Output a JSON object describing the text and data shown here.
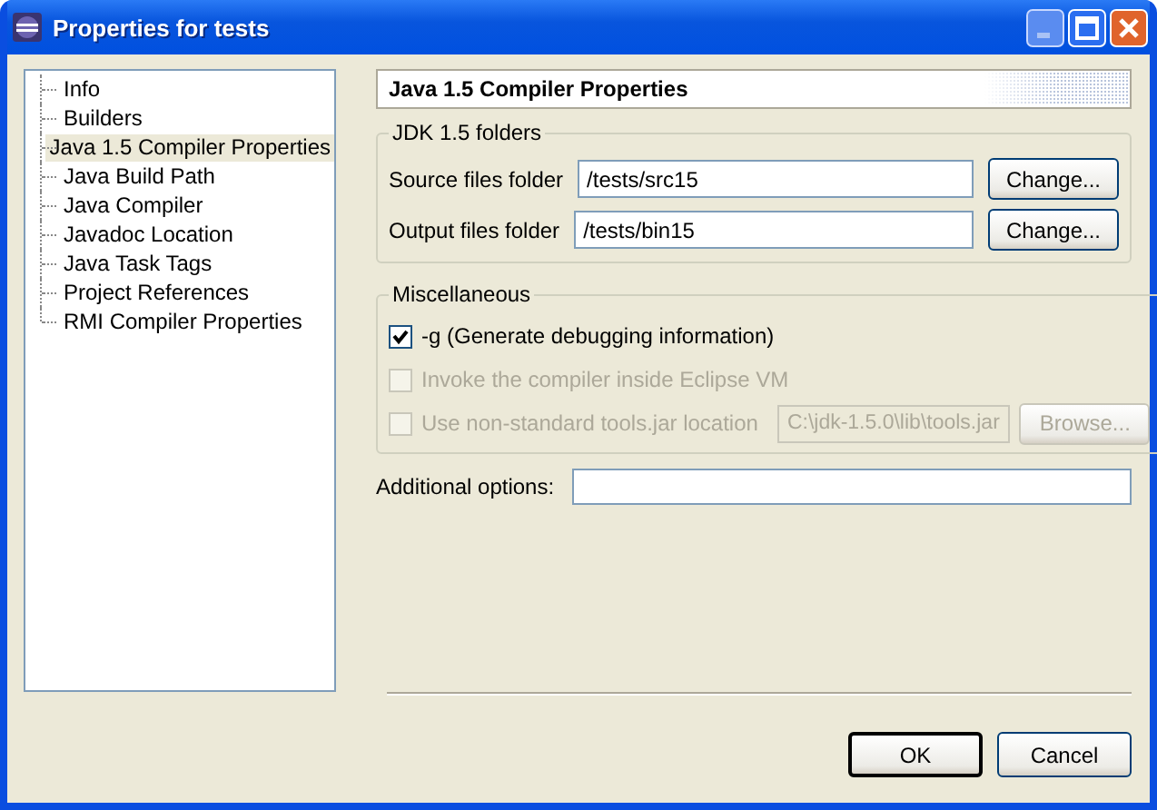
{
  "window": {
    "title": "Properties for tests"
  },
  "tree": {
    "items": [
      {
        "label": "Info",
        "selected": false
      },
      {
        "label": "Builders",
        "selected": false
      },
      {
        "label": "Java 1.5 Compiler Properties",
        "selected": true
      },
      {
        "label": "Java Build Path",
        "selected": false
      },
      {
        "label": "Java Compiler",
        "selected": false
      },
      {
        "label": "Javadoc Location",
        "selected": false
      },
      {
        "label": "Java Task Tags",
        "selected": false
      },
      {
        "label": "Project References",
        "selected": false
      },
      {
        "label": "RMI Compiler Properties",
        "selected": false
      }
    ]
  },
  "page": {
    "title": "Java 1.5 Compiler Properties",
    "folders": {
      "title": "JDK 1.5 folders",
      "rows": [
        {
          "label": "Source files folder",
          "value": "/tests/src15",
          "button": "Change..."
        },
        {
          "label": "Output files folder",
          "value": "/tests/bin15",
          "button": "Change..."
        }
      ]
    },
    "misc": {
      "title": "Miscellaneous",
      "options": [
        {
          "kind": "checkbox",
          "label": "-g (Generate debugging information)",
          "checked": true,
          "disabled": false
        },
        {
          "kind": "checkbox",
          "label": "Invoke the compiler inside Eclipse VM",
          "checked": false,
          "disabled": true
        },
        {
          "kind": "path",
          "label": "Use non-standard tools.jar location",
          "checked": false,
          "disabled": true,
          "value": "C:\\jdk-1.5.0\\lib\\tools.jar",
          "button": "Browse..."
        }
      ]
    },
    "additional": {
      "label": "Additional options:"
    }
  },
  "buttons": [
    "OK",
    "Cancel"
  ]
}
